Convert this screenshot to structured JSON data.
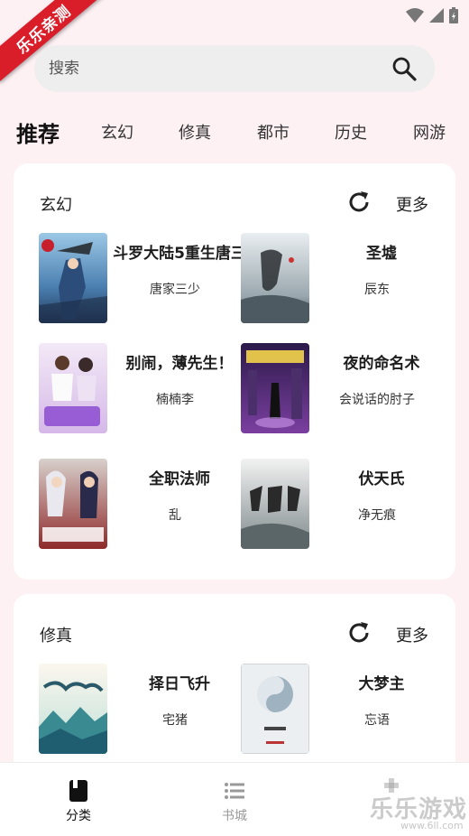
{
  "banner": {
    "text": "乐乐亲测"
  },
  "search": {
    "placeholder": "搜索"
  },
  "categories": {
    "main": "推荐",
    "items": [
      "玄幻",
      "修真",
      "都市",
      "历史",
      "网游"
    ]
  },
  "sections": [
    {
      "title": "玄幻",
      "more": "更多",
      "books": [
        {
          "title": "斗罗大陆5重生唐三",
          "author": "唐家三少"
        },
        {
          "title": "圣墟",
          "author": "辰东"
        },
        {
          "title": "别闹，薄先生！",
          "author": "楠楠李"
        },
        {
          "title": "夜的命名术",
          "author": "会说话的肘子"
        },
        {
          "title": "全职法师",
          "author": "乱"
        },
        {
          "title": "伏天氏",
          "author": "净无痕"
        }
      ]
    },
    {
      "title": "修真",
      "more": "更多",
      "books": [
        {
          "title": "择日飞升",
          "author": "宅猪"
        },
        {
          "title": "大梦主",
          "author": "忘语"
        }
      ]
    }
  ],
  "bottom_nav": [
    {
      "label": "分类",
      "icon": "book-icon",
      "active": true
    },
    {
      "label": "书城",
      "icon": "list-icon",
      "active": false
    }
  ],
  "watermark": {
    "text": "乐乐游戏",
    "url": "www.6ll.com"
  },
  "colors": {
    "background": "#fdf1f4",
    "banner": "#d91e2a",
    "card": "#ffffff"
  }
}
